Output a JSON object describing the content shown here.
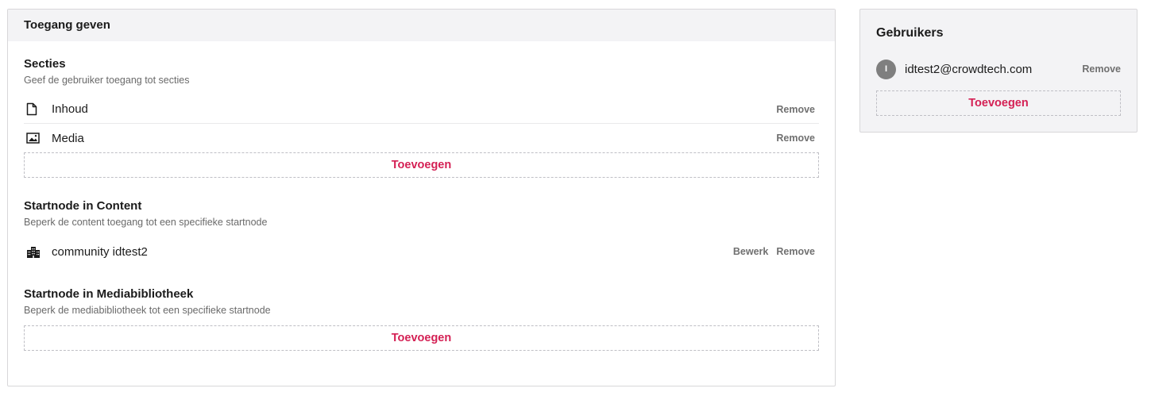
{
  "grant_access": {
    "header": "Toegang geven",
    "sections": {
      "title": "Secties",
      "description": "Geef de gebruiker toegang tot secties",
      "items": [
        {
          "label": "Inhoud",
          "icon": "document-icon",
          "remove": "Remove"
        },
        {
          "label": "Media",
          "icon": "image-icon",
          "remove": "Remove"
        }
      ],
      "add_label": "Toevoegen"
    },
    "startnode_content": {
      "title": "Startnode in Content",
      "description": "Beperk de content toegang tot een specifieke startnode",
      "item": {
        "label": "community idtest2",
        "icon": "building-icon",
        "edit": "Bewerk",
        "remove": "Remove"
      }
    },
    "startnode_media": {
      "title": "Startnode in Mediabibliotheek",
      "description": "Beperk de mediabibliotheek tot een specifieke startnode",
      "add_label": "Toevoegen"
    }
  },
  "users": {
    "title": "Gebruikers",
    "user": {
      "initial": "I",
      "email": "idtest2@crowdtech.com",
      "remove": "Remove"
    },
    "add_label": "Toevoegen"
  },
  "colors": {
    "accent": "#d42054",
    "panel_header_bg": "#f3f3f5",
    "muted_text": "#6a6a6a",
    "avatar_bg": "#7f7f7f"
  }
}
